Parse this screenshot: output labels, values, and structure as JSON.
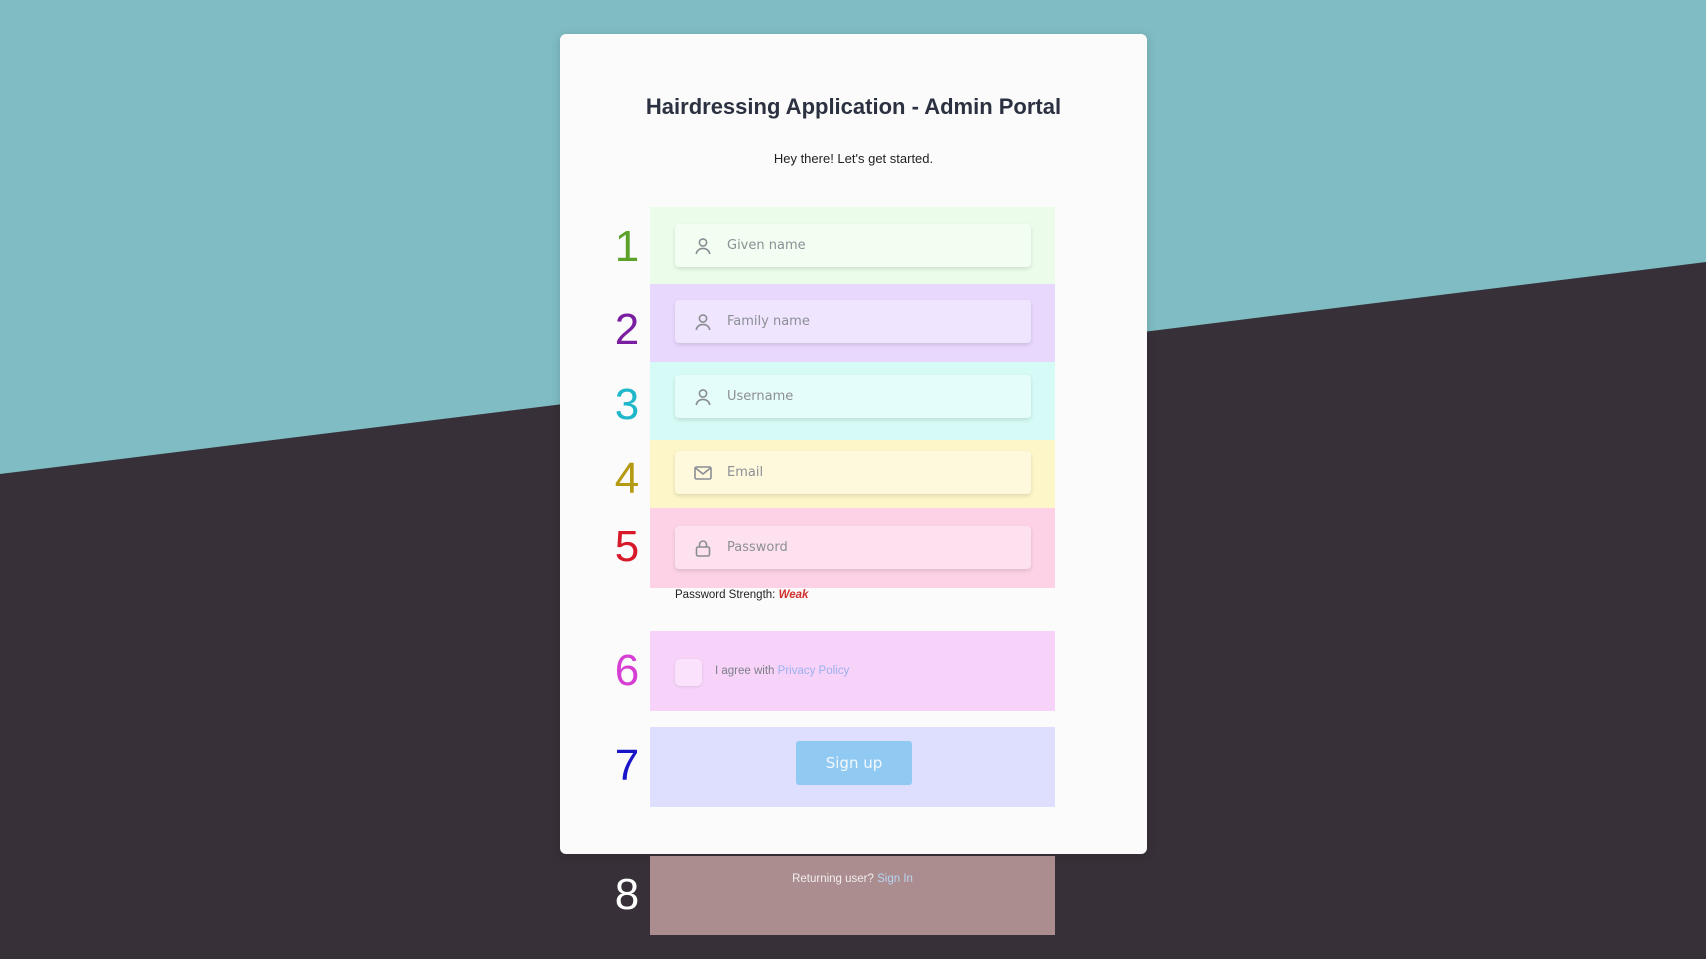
{
  "app": {
    "title": "Hairdressing Application - Admin Portal",
    "subtitle": "Hey there! Let's get started."
  },
  "form": {
    "fields": [
      {
        "marker": "1",
        "icon": "user-icon",
        "placeholder": "Given name",
        "value": "",
        "band_color": "#ebfdea",
        "marker_color": "#5ca22a"
      },
      {
        "marker": "2",
        "icon": "user-icon",
        "placeholder": "Family name",
        "value": "",
        "band_color": "#e9d8fd",
        "marker_color": "#7b1fa2"
      },
      {
        "marker": "3",
        "icon": "user-icon",
        "placeholder": "Username",
        "value": "",
        "band_color": "#d6fbf7",
        "marker_color": "#1fb7c9"
      },
      {
        "marker": "4",
        "icon": "mail-icon",
        "placeholder": "Email",
        "value": "",
        "band_color": "#fdf6c9",
        "marker_color": "#b59a14"
      },
      {
        "marker": "5",
        "icon": "lock-icon",
        "placeholder": "Password",
        "value": "",
        "band_color": "#fdd2e6",
        "marker_color": "#d8192a"
      }
    ],
    "password_strength": {
      "label": "Password Strength:",
      "value": "Weak"
    },
    "agree": {
      "marker": "6",
      "text": "I agree with",
      "link": "Privacy Policy",
      "checked": false,
      "band_color": "#f7d3fa",
      "marker_color": "#d63fd3"
    },
    "signup": {
      "marker": "7",
      "label": "Sign up",
      "band_color": "#dedffe",
      "marker_color": "#1a14c8"
    }
  },
  "footer": {
    "marker": "8",
    "text": "Returning user?",
    "link": "Sign In",
    "band_color": "#ab8d90",
    "marker_color": "#ffffff"
  },
  "colors": {
    "teal_background": "#7fbcc3",
    "dark_background": "#373038",
    "card": "#fbfbfb",
    "button": "#90caf3"
  }
}
